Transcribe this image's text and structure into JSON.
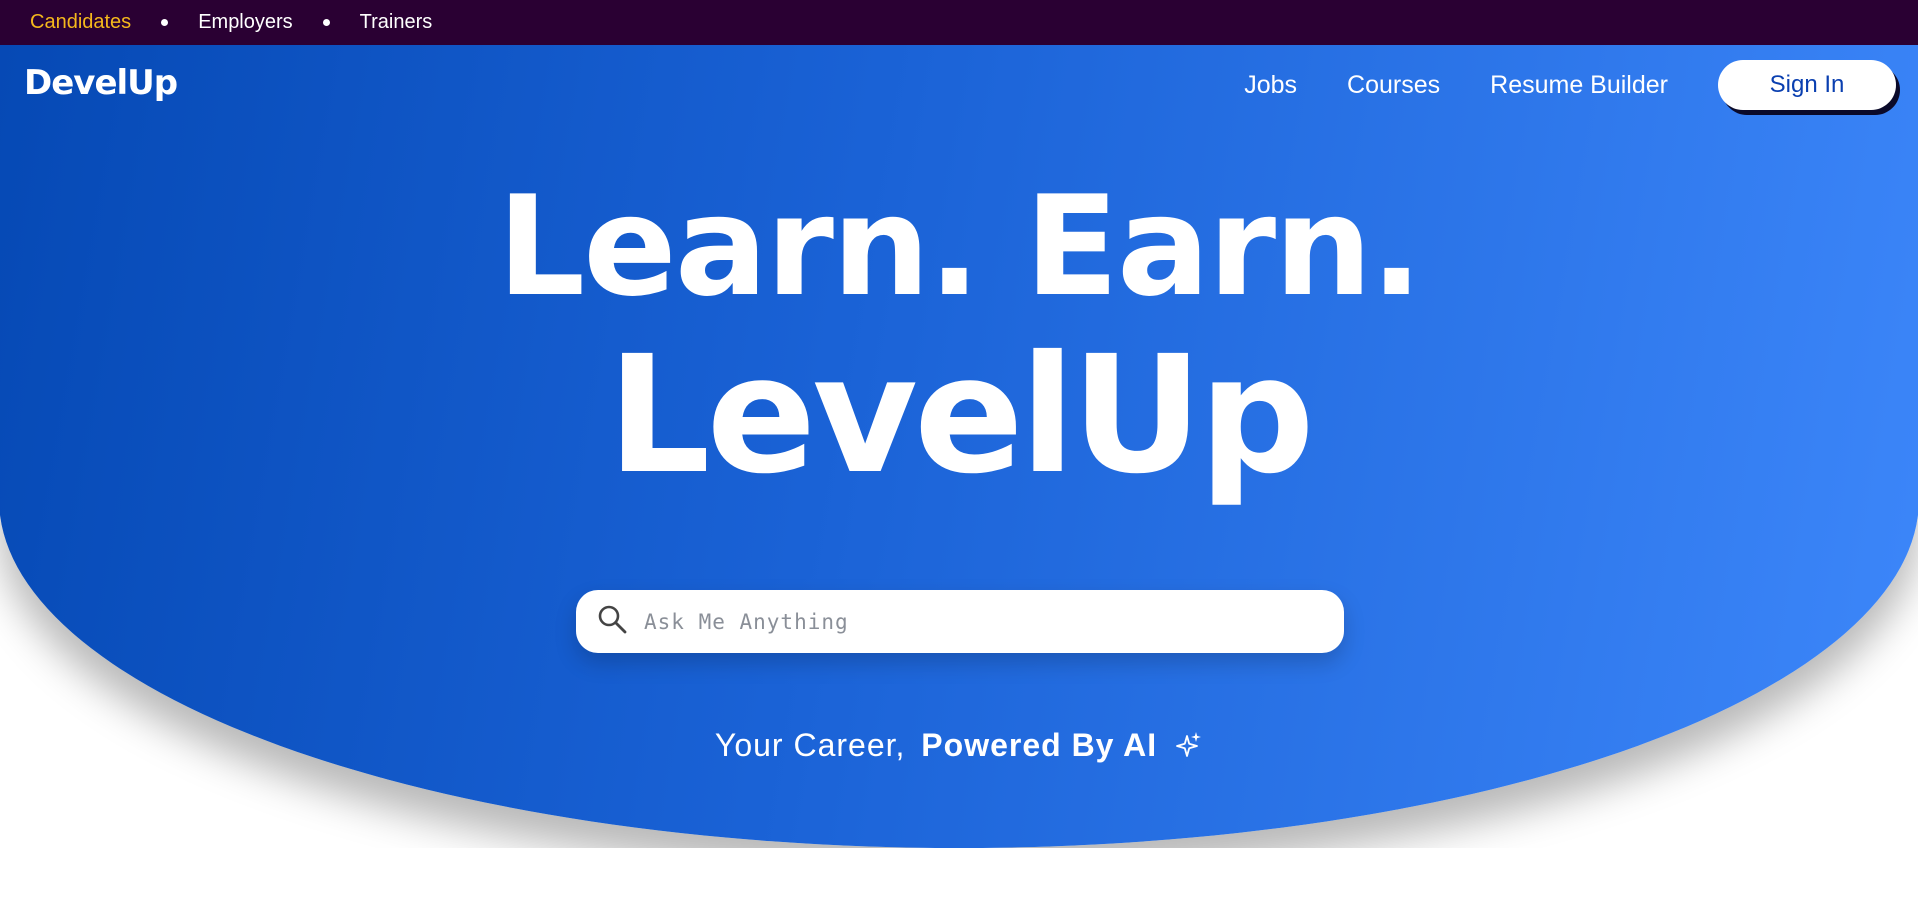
{
  "topbar": {
    "audiences": [
      "Candidates",
      "Employers",
      "Trainers"
    ],
    "active_color": "#f5b81c",
    "background": "#2a0033"
  },
  "brand": {
    "logo": "DevelUp"
  },
  "nav": {
    "links": [
      "Jobs",
      "Courses",
      "Resume Builder"
    ],
    "signin_label": "Sign In"
  },
  "hero": {
    "line1": "Learn. Earn.",
    "line2": "LevelUp",
    "gradient": [
      "#0447b2",
      "#3d87fa"
    ]
  },
  "search": {
    "placeholder": "Ask Me Anything",
    "icon": "search-icon"
  },
  "tagline": {
    "prefix": "Your Career,",
    "emphasis": "Powered By AI",
    "icon": "sparkle-icon"
  }
}
